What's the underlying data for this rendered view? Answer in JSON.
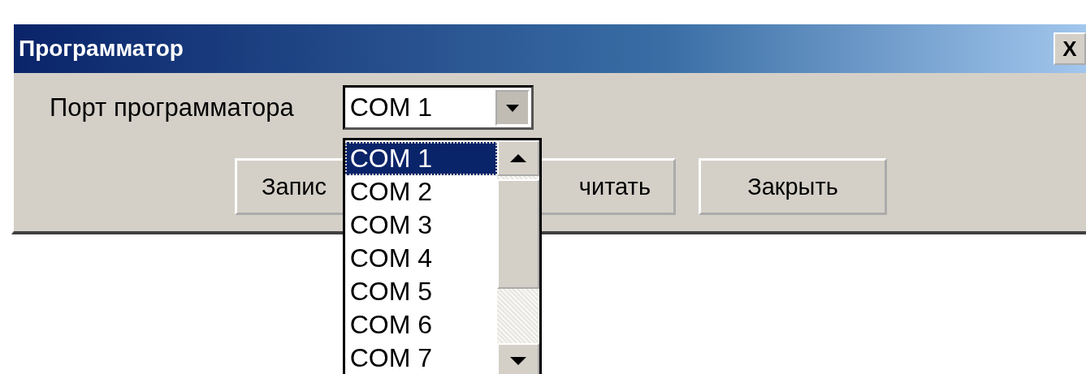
{
  "window": {
    "title": "Программатор",
    "close": "X"
  },
  "port": {
    "label": "Порт программатора",
    "value": "COM 1",
    "expanded": true,
    "options": [
      {
        "label": "COM 1",
        "selected": true
      },
      {
        "label": "COM 2",
        "selected": false
      },
      {
        "label": "COM 3",
        "selected": false
      },
      {
        "label": "COM 4",
        "selected": false
      },
      {
        "label": "COM 5",
        "selected": false
      },
      {
        "label": "COM 6",
        "selected": false
      },
      {
        "label": "COM 7",
        "selected": false
      }
    ]
  },
  "buttons": [
    {
      "label": "Запис"
    },
    {
      "label": "читать"
    },
    {
      "label": "Закрыть"
    }
  ]
}
